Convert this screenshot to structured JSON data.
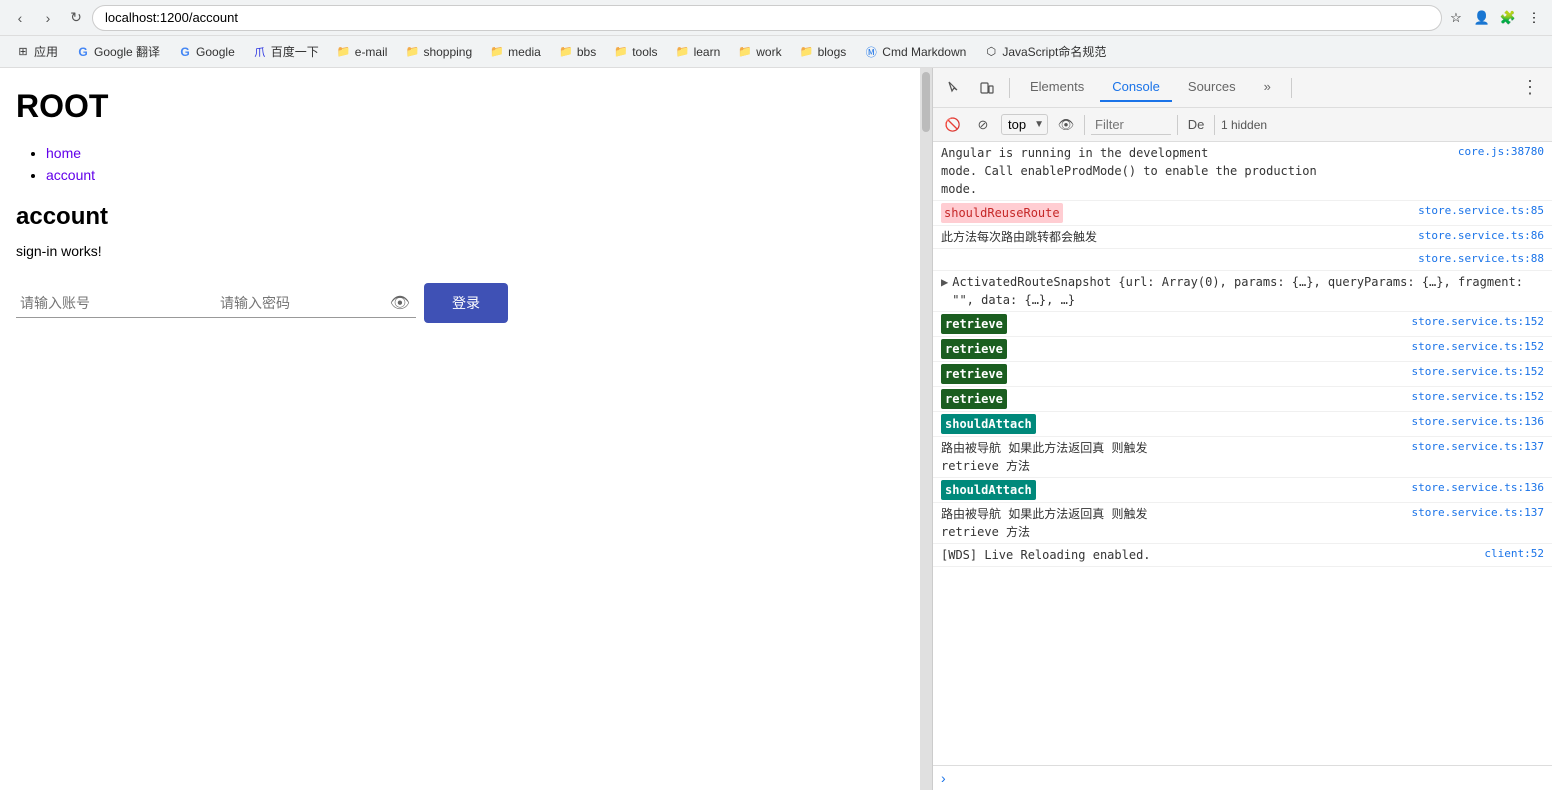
{
  "browser": {
    "address": "localhost:1200/account",
    "nav": {
      "back": "‹",
      "forward": "›",
      "refresh": "↻",
      "home": "⌂"
    }
  },
  "bookmarks": [
    {
      "label": "应用",
      "icon": "⊞",
      "type": "apps"
    },
    {
      "label": "Google 翻译",
      "icon": "G",
      "color": "#4285f4"
    },
    {
      "label": "Google",
      "icon": "G",
      "color": "#4285f4"
    },
    {
      "label": "百度一下",
      "icon": "爪",
      "color": "#2932e1"
    },
    {
      "label": "e-mail",
      "icon": "📁",
      "color": "#f6b900"
    },
    {
      "label": "shopping",
      "icon": "📁",
      "color": "#f6b900"
    },
    {
      "label": "media",
      "icon": "📁",
      "color": "#f6b900"
    },
    {
      "label": "bbs",
      "icon": "📁",
      "color": "#f6b900"
    },
    {
      "label": "tools",
      "icon": "📁",
      "color": "#f6b900"
    },
    {
      "label": "learn",
      "icon": "📁",
      "color": "#f6b900"
    },
    {
      "label": "work",
      "icon": "📁",
      "color": "#f6b900"
    },
    {
      "label": "blogs",
      "icon": "📁",
      "color": "#f6b900"
    },
    {
      "label": "Cmd Markdown",
      "icon": "Ⓜ",
      "color": "#1a73e8"
    },
    {
      "label": "JavaScript命名规范",
      "icon": "⬡",
      "color": "#333"
    }
  ],
  "page": {
    "title": "ROOT",
    "nav_links": [
      {
        "text": "home",
        "href": "#"
      },
      {
        "text": "account",
        "href": "#"
      }
    ],
    "section_title": "account",
    "sign_in_text": "sign-in works!",
    "form": {
      "username_placeholder": "请输入账号",
      "password_placeholder": "请输入密码",
      "login_label": "登录"
    }
  },
  "devtools": {
    "tabs": [
      {
        "label": "Elements",
        "active": false
      },
      {
        "label": "Console",
        "active": true
      },
      {
        "label": "Sources",
        "active": false
      },
      {
        "label": "»",
        "active": false
      }
    ],
    "console": {
      "context": "top",
      "filter_placeholder": "Filter",
      "default_levels": "De",
      "hidden_count": "1 hidden",
      "logs": [
        {
          "type": "info",
          "text": "Angular is running in the development\nmode. Call enableProdMode() to enable the production\nmode.",
          "link": "core.js:38780"
        },
        {
          "type": "highlight-pink",
          "label": "shouldReuseRoute",
          "text": "",
          "link": "store.service.ts:85"
        },
        {
          "type": "normal",
          "text": "此方法每次路由跳转都会触发",
          "link": "store.service.ts:86"
        },
        {
          "type": "normal",
          "text": "",
          "link": "store.service.ts:88"
        },
        {
          "type": "expandable",
          "text": "ActivatedRouteSnapshot {url: Array(0), params: {…}, queryParams: {…}, fragment: \"\", data: {…}, …}",
          "link": ""
        },
        {
          "type": "highlight-green",
          "label": "retrieve",
          "text": "",
          "link": "store.service.ts:152"
        },
        {
          "type": "highlight-green",
          "label": "retrieve",
          "text": "",
          "link": "store.service.ts:152"
        },
        {
          "type": "highlight-green",
          "label": "retrieve",
          "text": "",
          "link": "store.service.ts:152"
        },
        {
          "type": "highlight-green",
          "label": "retrieve",
          "text": "",
          "link": "store.service.ts:152"
        },
        {
          "type": "highlight-teal",
          "label": "shouldAttach",
          "text": "",
          "link": "store.service.ts:136"
        },
        {
          "type": "normal",
          "text": "路由被导航 如果此方法返回真 则触发\nretrieve 方法",
          "link": "store.service.ts:137"
        },
        {
          "type": "highlight-teal",
          "label": "shouldAttach",
          "text": "",
          "link": "store.service.ts:136"
        },
        {
          "type": "normal",
          "text": "路由被导航 如果此方法返回真 则触发\nretrieve 方法",
          "link": "store.service.ts:137"
        },
        {
          "type": "normal",
          "text": "[WDS] Live Reloading enabled.",
          "link": "client:52"
        }
      ]
    }
  }
}
